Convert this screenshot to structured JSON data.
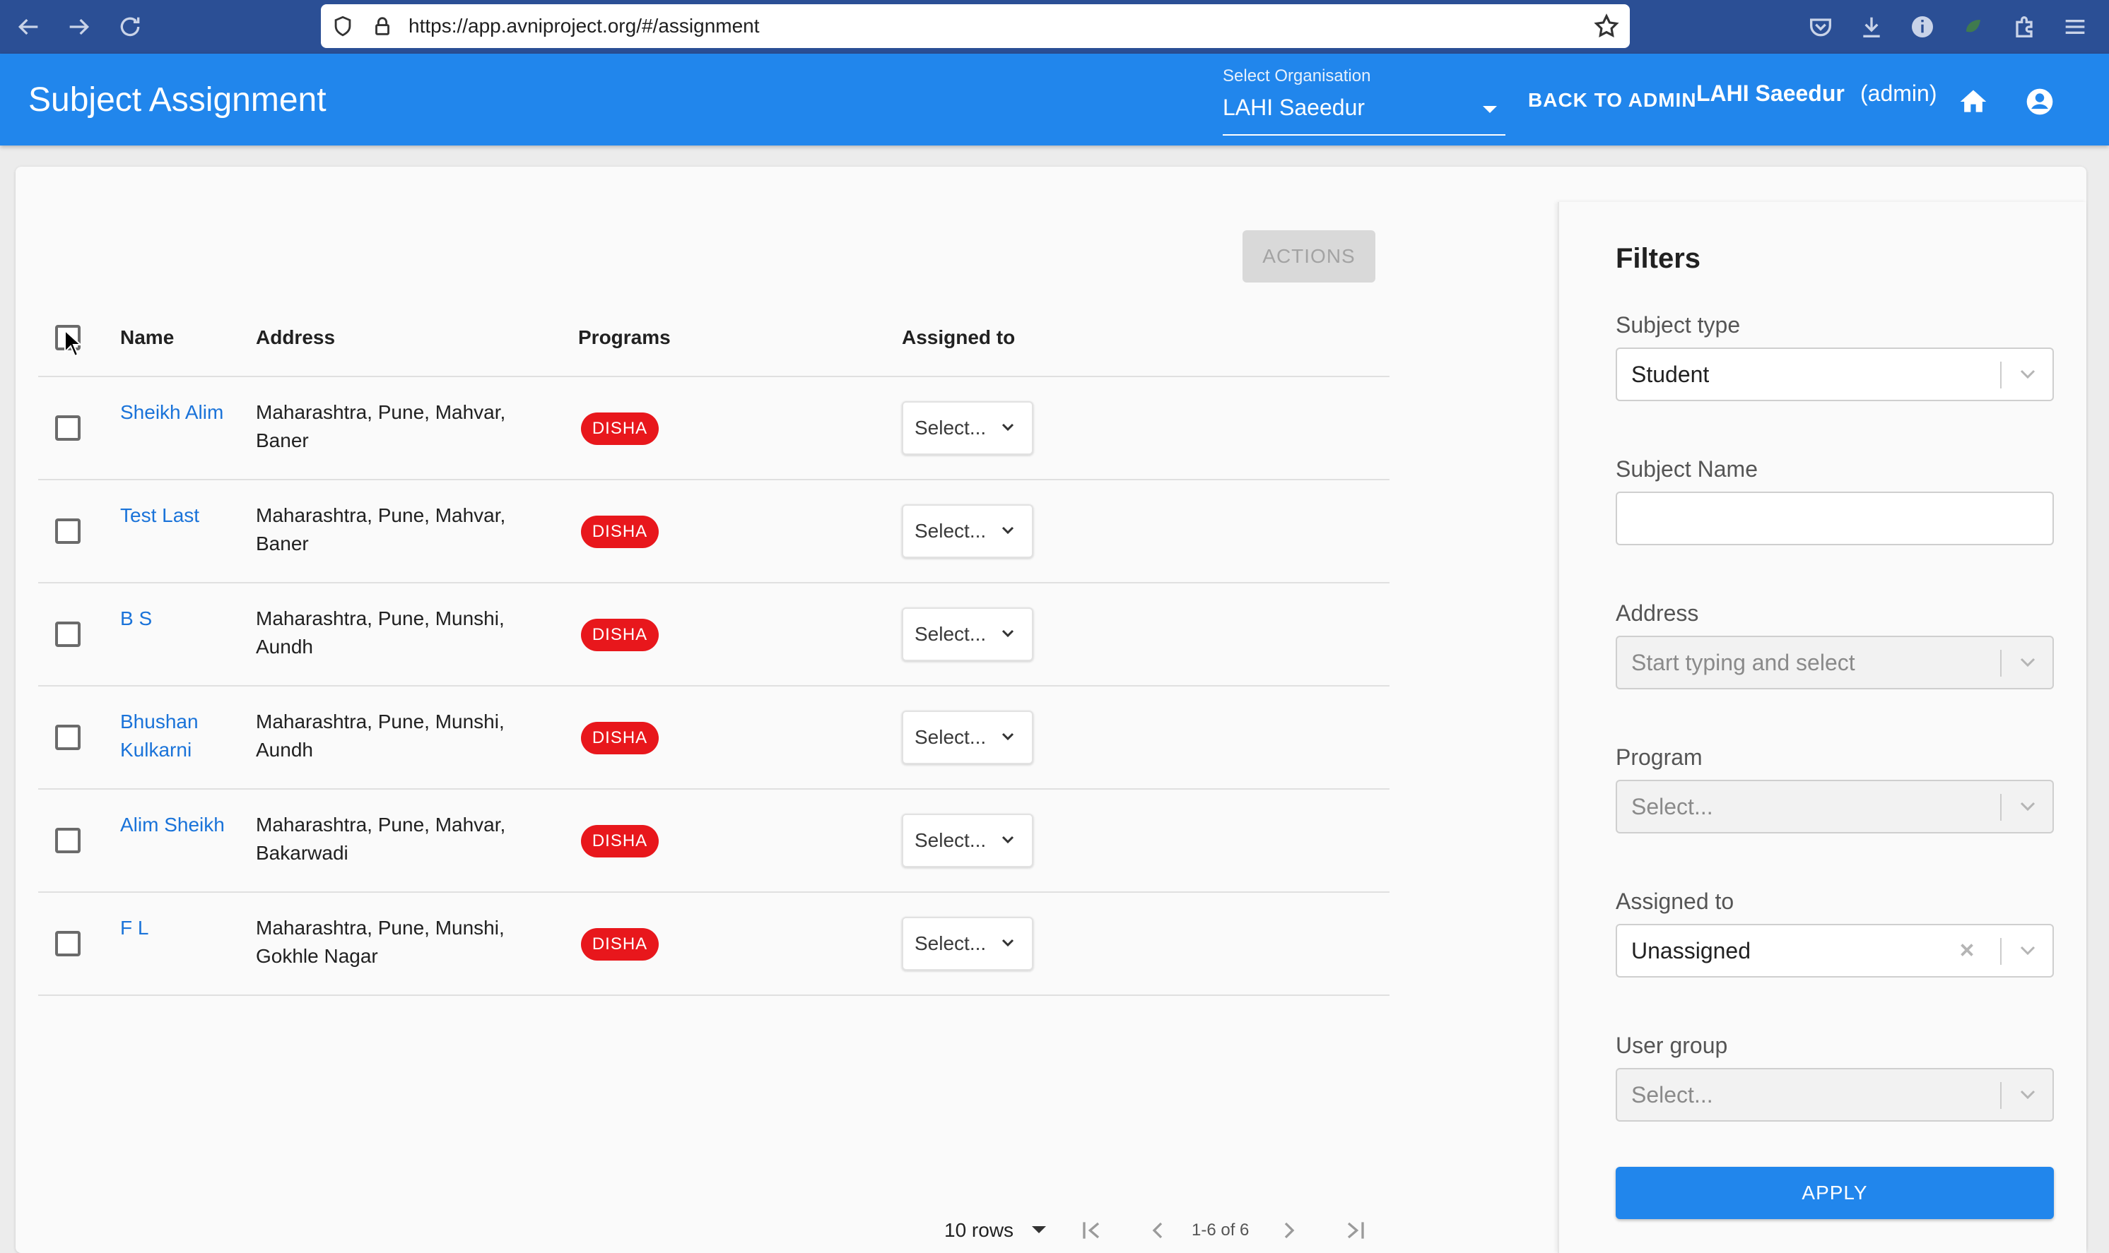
{
  "browser": {
    "url": "https://app.avniproject.org/#/assignment"
  },
  "header": {
    "title": "Subject Assignment",
    "org_label": "Select Organisation",
    "org_value": "LAHI Saeedur",
    "back_to_admin": "BACK TO ADMIN",
    "user_name": "LAHI Saeedur",
    "user_role": "(admin)"
  },
  "toolbar": {
    "actions_label": "ACTIONS"
  },
  "table": {
    "columns": [
      "Name",
      "Address",
      "Programs",
      "Assigned to"
    ],
    "rows": [
      {
        "name": "Sheikh Alim",
        "address": "Maharashtra, Pune, Mahvar, Baner",
        "program": "DISHA",
        "assigned": "Select..."
      },
      {
        "name": "Test Last",
        "address": "Maharashtra, Pune, Mahvar, Baner",
        "program": "DISHA",
        "assigned": "Select..."
      },
      {
        "name": "B S",
        "address": "Maharashtra, Pune, Munshi, Aundh",
        "program": "DISHA",
        "assigned": "Select..."
      },
      {
        "name": "Bhushan Kulkarni",
        "address": "Maharashtra, Pune, Munshi, Aundh",
        "program": "DISHA",
        "assigned": "Select..."
      },
      {
        "name": "Alim Sheikh",
        "address": "Maharashtra, Pune, Mahvar, Bakarwadi",
        "program": "DISHA",
        "assigned": "Select..."
      },
      {
        "name": "F L",
        "address": "Maharashtra, Pune, Munshi, Gokhle Nagar",
        "program": "DISHA",
        "assigned": "Select..."
      }
    ]
  },
  "pagination": {
    "rows_per_page": "10 rows",
    "range": "1-6 of 6"
  },
  "filters": {
    "title": "Filters",
    "subject_type": {
      "label": "Subject type",
      "value": "Student"
    },
    "subject_name": {
      "label": "Subject Name",
      "value": ""
    },
    "address": {
      "label": "Address",
      "placeholder": "Start typing and select"
    },
    "program": {
      "label": "Program",
      "placeholder": "Select..."
    },
    "assigned_to": {
      "label": "Assigned to",
      "value": "Unassigned"
    },
    "user_group": {
      "label": "User group",
      "placeholder": "Select..."
    },
    "apply_label": "APPLY"
  },
  "colors": {
    "header_blue": "#2186ec",
    "chip_red": "#e8171c",
    "link_blue": "#1a73d9"
  }
}
